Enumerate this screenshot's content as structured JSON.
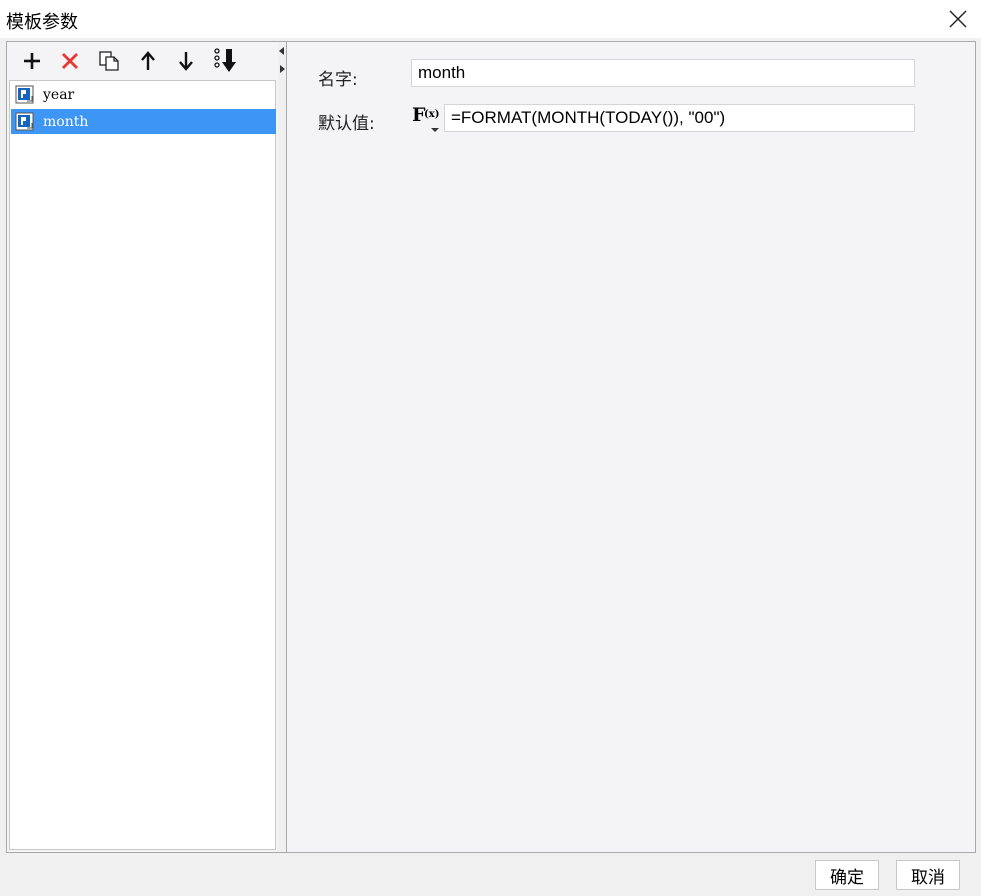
{
  "window": {
    "title": "模板参数"
  },
  "toolbar": {
    "add_icon": "plus-icon",
    "delete_icon": "delete-x-icon",
    "copy_icon": "copy-icon",
    "move_up_icon": "arrow-up-icon",
    "move_down_icon": "arrow-down-icon",
    "sort_icon": "sort-down-icon",
    "delete_color": "#e53935"
  },
  "params": [
    {
      "name": "year",
      "selected": false
    },
    {
      "name": "month",
      "selected": true
    }
  ],
  "form": {
    "name_label": "名字:",
    "name_value": "month",
    "default_label": "默认值:",
    "formula_button_text": "F",
    "formula_button_sub": "(x)",
    "default_value": "=FORMAT(MONTH(TODAY()), \"00\")"
  },
  "buttons": {
    "ok": "确定",
    "cancel": "取消"
  },
  "colors": {
    "selection": "#3d95f4",
    "param_icon_blue": "#1565c0"
  }
}
